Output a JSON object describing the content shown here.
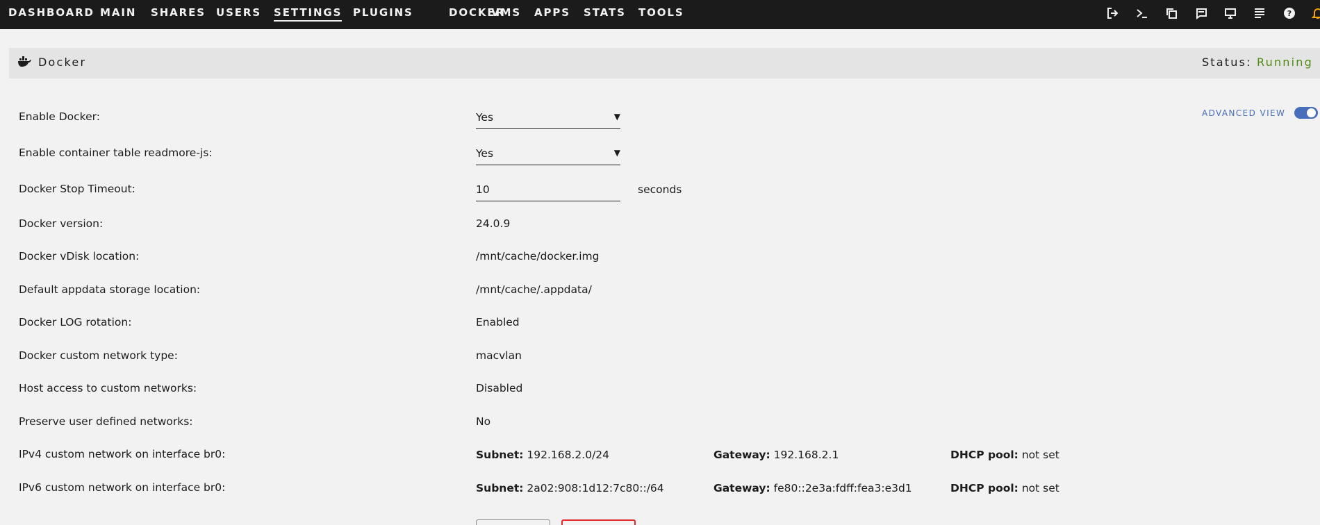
{
  "nav": {
    "tabs": [
      "DASHBOARD",
      "MAIN",
      "SHARES",
      "USERS",
      "SETTINGS",
      "PLUGINS",
      "DOCKER",
      "VMS",
      "APPS",
      "STATS",
      "TOOLS"
    ],
    "active_tab": "SETTINGS",
    "icons": [
      "logout-icon",
      "terminal-icon",
      "copy-icon",
      "feedback-icon",
      "display-icon",
      "log-icon",
      "help-icon",
      "bell-icon"
    ]
  },
  "header": {
    "title": "Docker",
    "status_label": "Status:",
    "status_value": "Running",
    "status_color": "#4f8a10"
  },
  "advanced_view": {
    "label": "ADVANCED VIEW",
    "enabled": true
  },
  "settings": {
    "enable_docker": {
      "label": "Enable Docker:",
      "value": "Yes"
    },
    "readmore": {
      "label": "Enable container table readmore-js:",
      "value": "Yes"
    },
    "stop_timeout": {
      "label": "Docker Stop Timeout:",
      "value": "10",
      "unit": "seconds"
    },
    "version": {
      "label": "Docker version:",
      "value": "24.0.9"
    },
    "vdisk": {
      "label": "Docker vDisk location:",
      "value": "/mnt/cache/docker.img"
    },
    "appdata": {
      "label": "Default appdata storage location:",
      "value": "/mnt/cache/.appdata/"
    },
    "log_rotation": {
      "label": "Docker LOG rotation:",
      "value": "Enabled"
    },
    "network_type": {
      "label": "Docker custom network type:",
      "value": "macvlan"
    },
    "host_access": {
      "label": "Host access to custom networks:",
      "value": "Disabled"
    },
    "preserve": {
      "label": "Preserve user defined networks:",
      "value": "No"
    }
  },
  "networks": {
    "ipv4": {
      "label": "IPv4 custom network on interface br0:",
      "subnet_label": "Subnet:",
      "subnet": "192.168.2.0/24",
      "gateway_label": "Gateway:",
      "gateway": "192.168.2.1",
      "dhcp_label": "DHCP pool:",
      "dhcp": "not set"
    },
    "ipv6": {
      "label": "IPv6 custom network on interface br0:",
      "subnet_label": "Subnet:",
      "subnet": "2a02:908:1d12:7c80::/64",
      "gateway_label": "Gateway:",
      "gateway": "fe80::2e3a:fdff:fea3:e3d1",
      "dhcp_label": "DHCP pool:",
      "dhcp": "not set"
    }
  },
  "colors": {
    "nav_bg": "#1c1b1b",
    "accent": "#486dba",
    "done_border": "#e22828"
  }
}
